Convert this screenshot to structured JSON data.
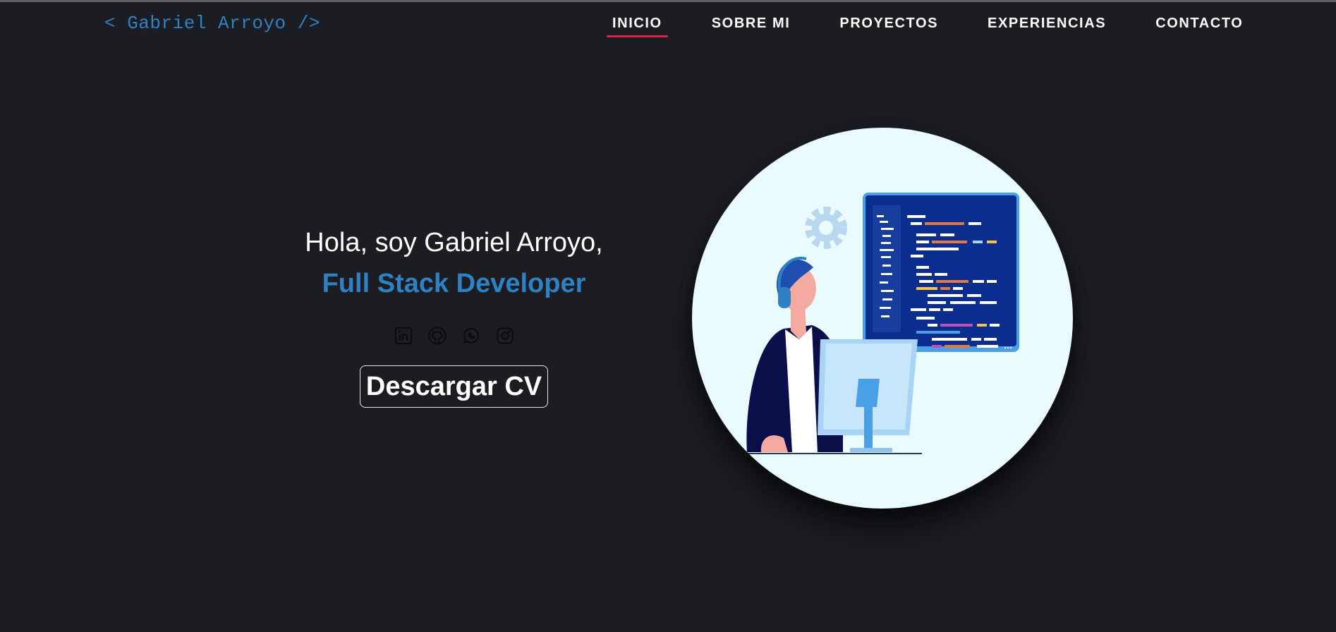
{
  "header": {
    "brand": "< Gabriel Arroyo />",
    "nav": [
      {
        "label": "INICIO",
        "active": true
      },
      {
        "label": "SOBRE MI",
        "active": false
      },
      {
        "label": "PROYECTOS",
        "active": false
      },
      {
        "label": "EXPERIENCIAS",
        "active": false
      },
      {
        "label": "CONTACTO",
        "active": false
      }
    ]
  },
  "hero": {
    "greeting": "Hola, soy Gabriel Arroyo,",
    "role": "Full Stack Developer",
    "socials": [
      {
        "icon": "linkedin-icon"
      },
      {
        "icon": "github-icon"
      },
      {
        "icon": "whatsapp-icon"
      },
      {
        "icon": "instagram-icon"
      }
    ],
    "cv_button": "Descargar CV"
  },
  "colors": {
    "background": "#1b1d22",
    "accent_blue": "#2e82c4",
    "active_underline": "#e1234f",
    "illustration_bg": "#e9fbfd"
  }
}
